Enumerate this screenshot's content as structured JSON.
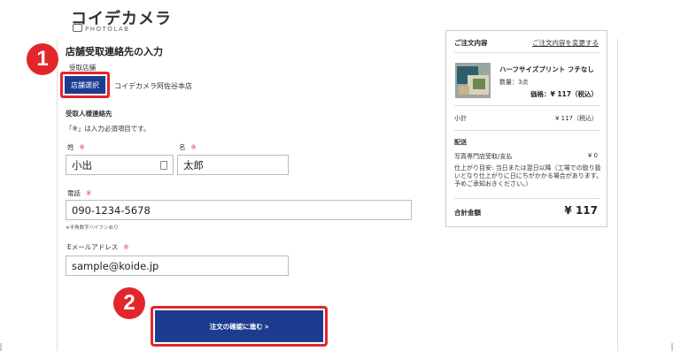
{
  "header": {
    "logo_main": "コイデカメラ",
    "logo_sub": "PHOTOLAB"
  },
  "form": {
    "section_title": "店舗受取連絡先の入力",
    "store_label": "受取店舗",
    "store_button": "店舗選択",
    "store_name": "コイデカメラ阿佐谷本店",
    "contact_heading": "受取人様連絡先",
    "required_note": "「※」は入力必須項目です。",
    "required_mark": "※",
    "last_name_label": "姓",
    "last_name_value": "小出",
    "first_name_label": "名",
    "first_name_value": "太郎",
    "phone_label": "電話",
    "phone_value": "090-1234-5678",
    "phone_hint": "※半角数字ハイフンあり",
    "email_label": "Eメールアドレス",
    "email_value": "sample@koide.jp",
    "submit_button": "注文の確認に進む >"
  },
  "badges": {
    "one": "1",
    "two": "2"
  },
  "summary": {
    "heading": "ご注文内容",
    "change_link": "ご注文内容を変更する",
    "product_name": "ハーフサイズプリント フチなし",
    "quantity": "数量：3点",
    "price": "価格：¥ 117（税込）",
    "subtotal_label": "小計",
    "subtotal_value": "¥ 117（税込）",
    "shipping_label": "配送",
    "shipping_method": "写真専門店受取/支払",
    "shipping_value": "¥ 0",
    "shipping_note": "仕上がり目安: 当日または翌日以降（工場での取り扱いとなり仕上がりに日にちがかかる場合があります。予めご承知おきください。）",
    "total_label": "合計金額",
    "total_value": "¥ 117"
  },
  "colors": {
    "accent_blue": "#1c3c8f",
    "highlight_red": "#e3262b"
  }
}
